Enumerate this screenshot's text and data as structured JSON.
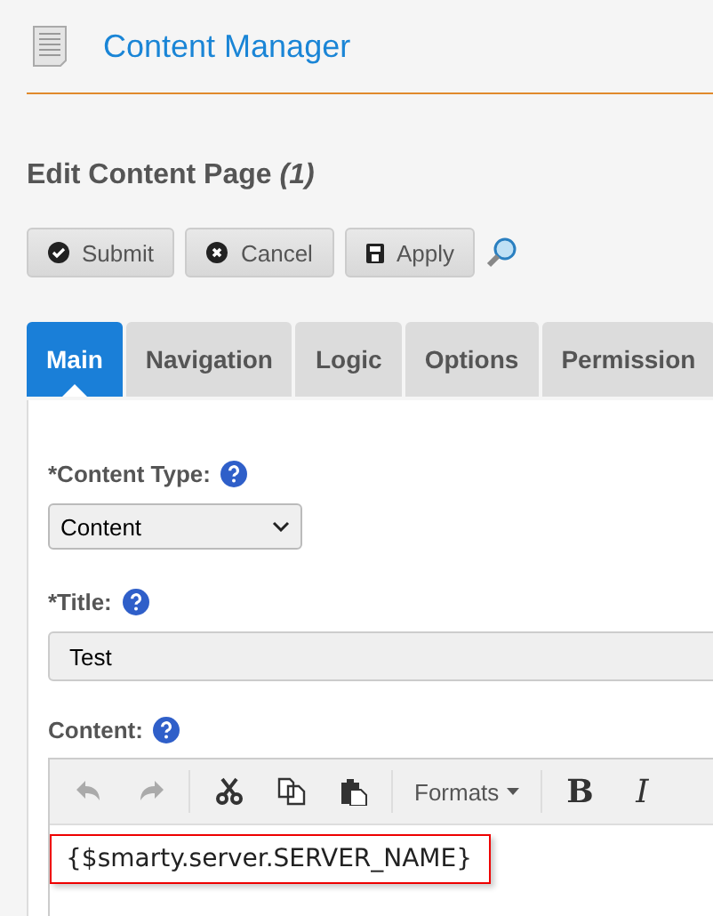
{
  "header": {
    "title": "Content Manager"
  },
  "page_title": "Edit Content Page *(1)*",
  "buttons": [
    {
      "label": "Submit",
      "kind": "submit"
    },
    {
      "label": "Cancel",
      "kind": "cancel"
    },
    {
      "label": "Apply",
      "kind": "apply"
    }
  ],
  "tabs": [
    {
      "label": "Main",
      "selected": true
    },
    {
      "label": "Navigation",
      "selected": false
    },
    {
      "label": "Logic",
      "selected": false
    },
    {
      "label": "Options",
      "selected": false
    },
    {
      "label": "Permission",
      "selected": false
    }
  ],
  "content_type": {
    "label": "*Content Type:",
    "value": "Content"
  },
  "title_field": {
    "label": "*Title:",
    "value": "Test"
  },
  "content": {
    "label": "Content:",
    "toolbar": [
      {
        "kind": "undo",
        "disabled": true
      },
      {
        "kind": "redo",
        "disabled": true
      },
      {
        "kind": "sep"
      },
      {
        "kind": "cut",
        "disabled": false
      },
      {
        "kind": "copy",
        "disabled": false
      },
      {
        "kind": "paste",
        "disabled": false
      },
      {
        "kind": "sep"
      },
      {
        "kind": "menu",
        "label": "Formats"
      },
      {
        "kind": "sep"
      },
      {
        "kind": "bold",
        "label": "B"
      },
      {
        "kind": "italic",
        "label": "I"
      }
    ],
    "text": "{$smarty.server.SERVER_NAME}"
  }
}
